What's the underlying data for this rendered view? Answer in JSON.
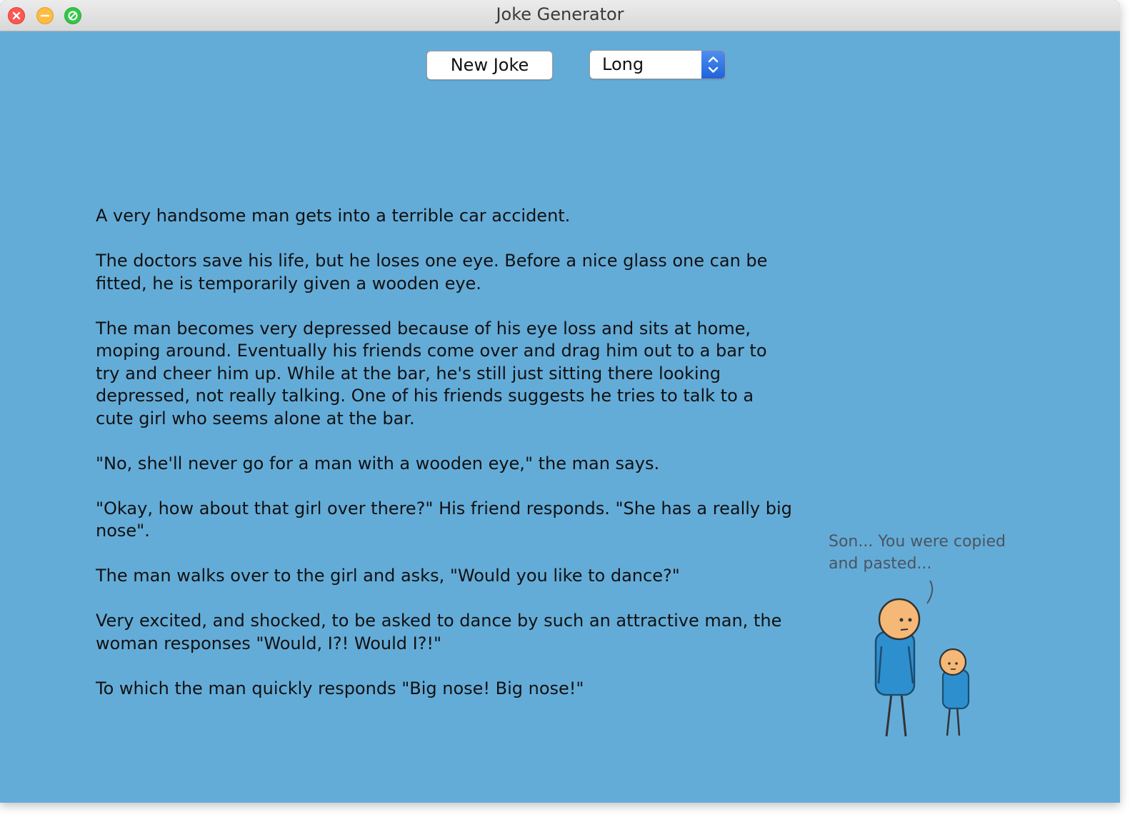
{
  "window": {
    "title": "Joke Generator"
  },
  "toolbar": {
    "new_joke_label": "New Joke",
    "length_select": {
      "selected": "Long"
    }
  },
  "joke": {
    "paragraphs": [
      "A very handsome man gets into a terrible car accident.",
      "The doctors save his life, but he loses one eye. Before a nice glass one can be fitted, he is temporarily given a wooden eye.",
      "The man becomes very depressed because of his eye loss and sits at home, moping around. Eventually his friends come over and drag him out to a bar to try and cheer him up. While at the bar, he's still just sitting there looking depressed, not really talking. One of his friends suggests he tries to talk to a cute girl who seems alone at the bar.",
      "\"No, she'll never go for a man with a wooden eye,\" the man says.",
      "\"Okay, how about that girl over there?\" His friend responds. \"She has a really big nose\".",
      "The man walks over to the girl and asks, \"Would you like to dance?\"",
      "Very excited, and shocked, to be asked to dance by such an attractive man, the woman responses \"Would, I?! Would I?!\"",
      "To which the man quickly responds \"Big nose! Big nose!\""
    ]
  },
  "comic": {
    "caption_line1": "Son... You were copied",
    "caption_line2": "and pasted..."
  },
  "colors": {
    "background": "#64acd8",
    "stepper_accent": "#2a6fe0",
    "figure_body": "#2e8fcf",
    "figure_head": "#f6b877"
  },
  "icons": [
    "close-icon",
    "minimize-icon",
    "zoom-icon",
    "chevron-up-icon",
    "chevron-down-icon"
  ]
}
